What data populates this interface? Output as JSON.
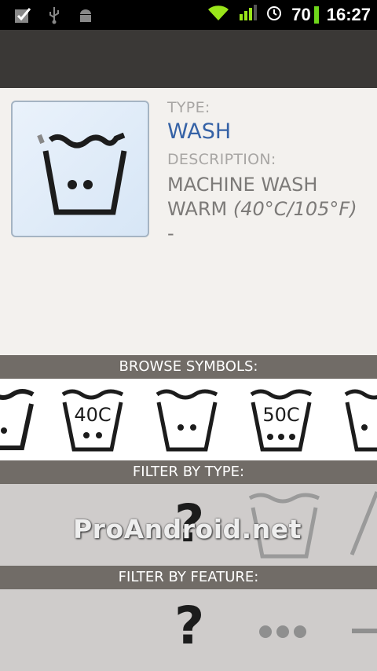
{
  "status_bar": {
    "battery": "70",
    "time": "16:27"
  },
  "detail": {
    "type_label": "TYPE:",
    "type_value": "WASH",
    "description_label": "DESCRIPTION:",
    "description_main": "MACHINE WASH WARM",
    "description_temp": "(40°C/105°F)",
    "description_extra": "-"
  },
  "sections": {
    "browse": "BROWSE SYMBOLS:",
    "filter_type": "FILTER BY TYPE:",
    "filter_feature": "FILTER BY FEATURE:"
  },
  "browse_symbols": {
    "sym1_text": "40C",
    "sym2_text": "50C"
  },
  "filter_type": {
    "question": "?"
  },
  "filter_feature": {
    "question": "?"
  },
  "watermark": "ProAndroid.net"
}
